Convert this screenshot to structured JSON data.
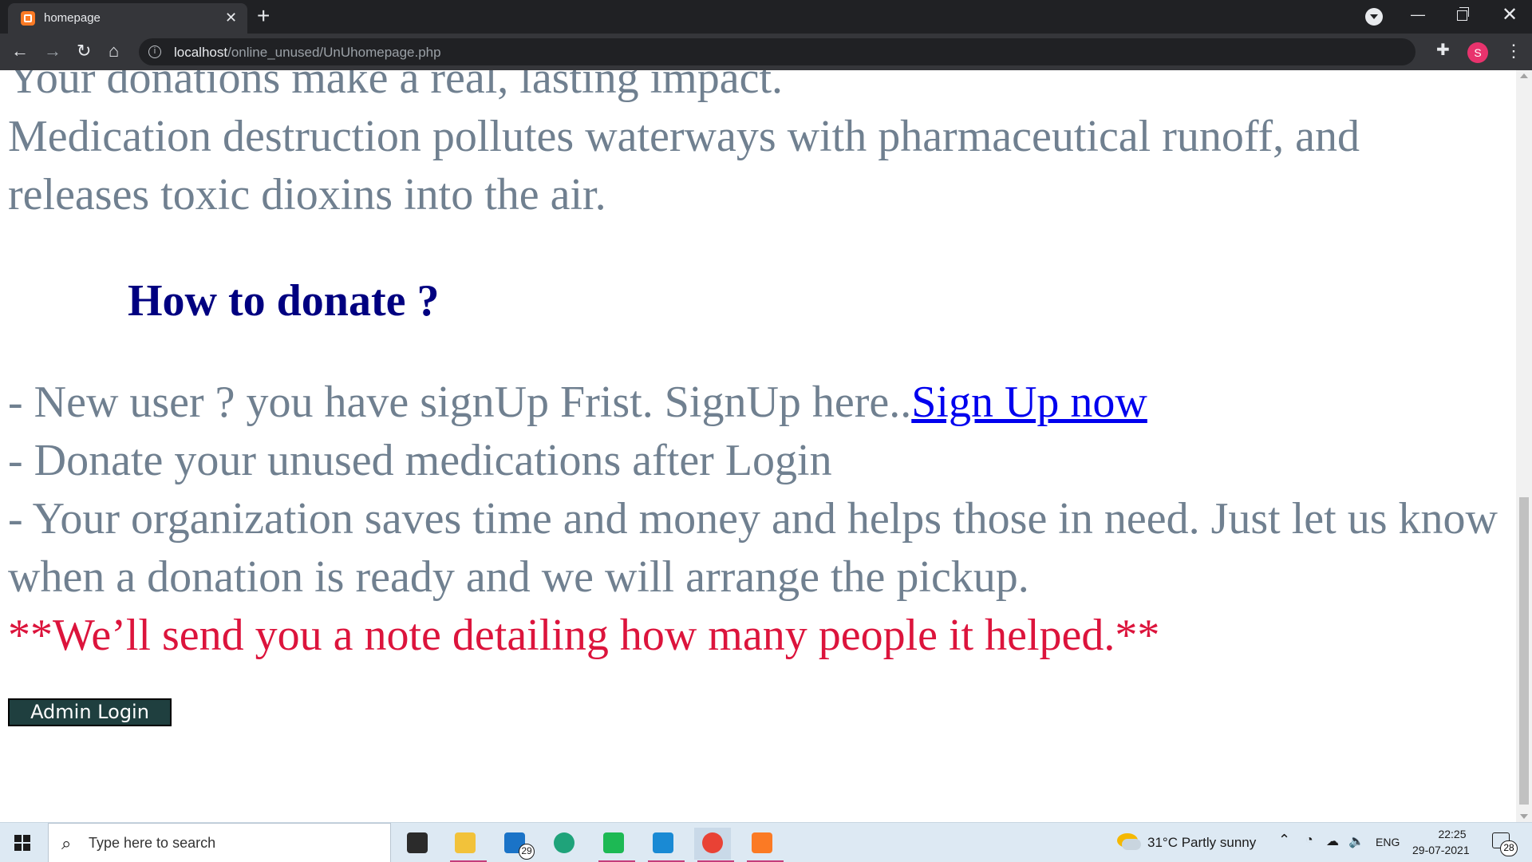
{
  "browser": {
    "tab_title": "homepage",
    "tab_close": "✕",
    "new_tab": "+",
    "url_host": "localhost",
    "url_path": "/online_unused/UnUhomepage.php",
    "avatar_letter": "S"
  },
  "page": {
    "intro_line": "Your donations make a real, lasting impact.",
    "pollution_text": "Medication destruction pollutes waterways with pharmaceutical runoff, and releases toxic dioxins into the air.",
    "heading": "How to donate ?",
    "step_new_user": "- New user ? you have signUp Frist. SignUp here..",
    "signup_link": "Sign Up now",
    "step_donate": "- Donate your unused medications after Login",
    "step_org": "- Your organization saves time and money and helps those in need. Just let us know when a donation is ready and we will arrange the pickup.",
    "note": "**We’ll send you a note detailing how many people it helped.**",
    "admin_button": "Admin Login"
  },
  "taskbar": {
    "search_placeholder": "Type here to search",
    "mail_badge": "29",
    "weather": "31°C  Partly sunny",
    "language": "ENG",
    "time": "22:25",
    "date": "29-07-2021",
    "notification_count": "28"
  },
  "colors": {
    "body_text": "#708090",
    "heading": "#000080",
    "link": "#0000ee",
    "note": "#dc143c",
    "admin_button_bg": "#1f3f3f"
  }
}
